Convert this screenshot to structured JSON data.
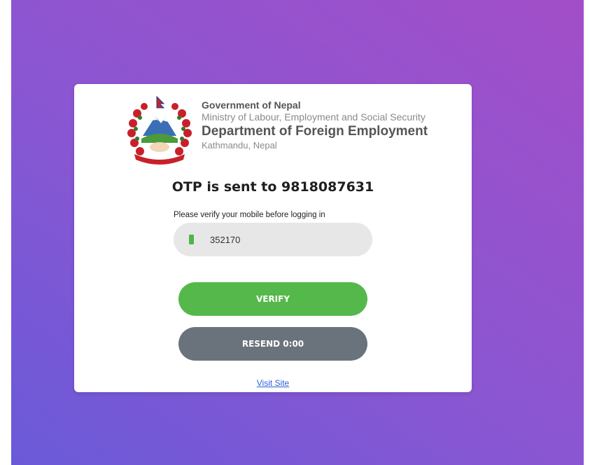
{
  "header": {
    "government": "Government of Nepal",
    "ministry": "Ministry of Labour, Employment and Social Security",
    "department": "Department of Foreign Employment",
    "location": "Kathmandu, Nepal",
    "emblem_icon": "nepal-national-emblem"
  },
  "otp": {
    "title": "OTP is sent to 9818087631",
    "instruction": "Please verify your mobile before logging in",
    "input_value": "352170",
    "input_icon": "mobile-phone-icon"
  },
  "buttons": {
    "verify_label": "VERIFY",
    "resend_label": "RESEND 0:00"
  },
  "footer": {
    "link_label": "Visit Site"
  },
  "colors": {
    "verify": "#55b84a",
    "resend": "#6a737b",
    "link": "#2c60d6",
    "background_start": "#6a5ad8",
    "background_end": "#a24ec8"
  }
}
